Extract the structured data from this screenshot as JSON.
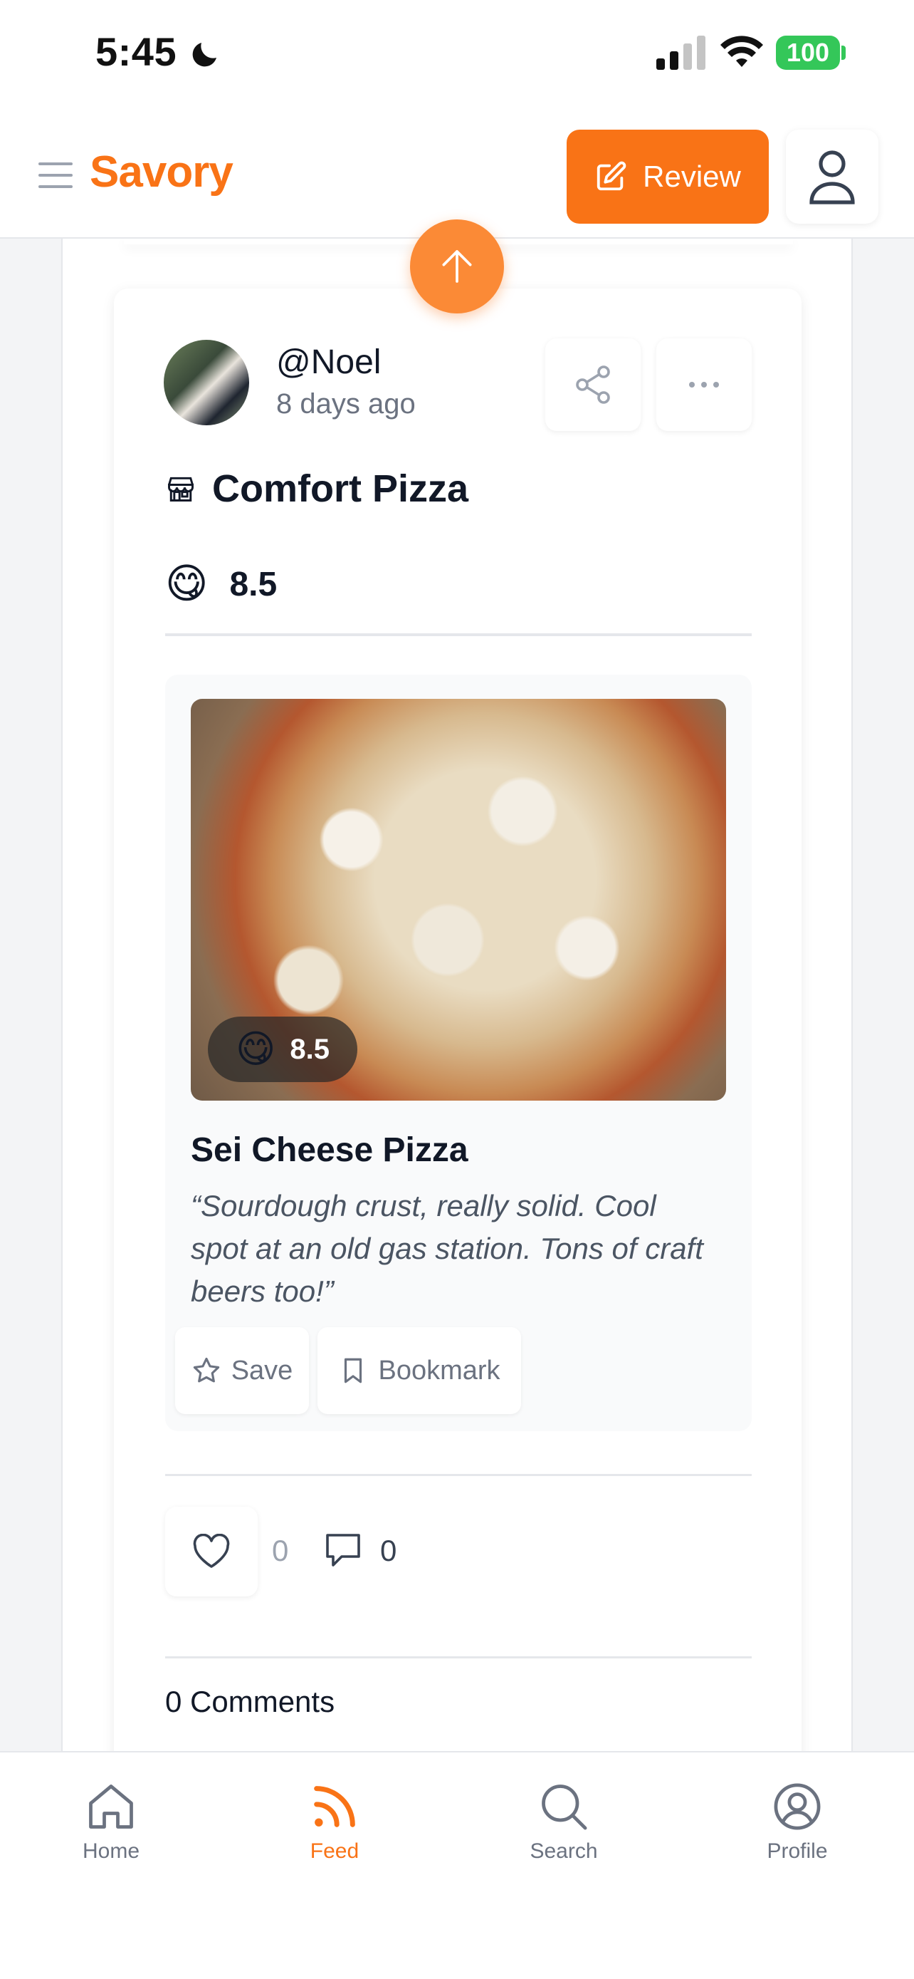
{
  "status_bar": {
    "time": "5:45",
    "battery": "100"
  },
  "header": {
    "logo": "Savory",
    "review_label": "Review",
    "icons": [
      "menu-icon",
      "edit-icon",
      "user-icon"
    ]
  },
  "post": {
    "username": "@Noel",
    "time_ago": "8 days ago",
    "restaurant": "Comfort Pizza",
    "rating_emoji": "😋",
    "rating": "8.5",
    "dish": {
      "name": "Sei Cheese Pizza",
      "rating_emoji": "😋",
      "rating": "8.5",
      "review": "“Sourdough crust, really solid. Cool spot at an old gas station. Tons of craft beers too!”",
      "save_label": "Save",
      "bookmark_label": "Bookmark"
    },
    "likes": "0",
    "comments": "0",
    "comments_title": "0 Comments"
  },
  "bottom_nav": {
    "items": [
      {
        "label": "Home",
        "icon": "home-icon"
      },
      {
        "label": "Feed",
        "icon": "rss-icon",
        "active": true
      },
      {
        "label": "Search",
        "icon": "search-icon"
      },
      {
        "label": "Profile",
        "icon": "profile-icon"
      }
    ]
  },
  "colors": {
    "accent": "#f97316",
    "battery": "#34c759"
  }
}
